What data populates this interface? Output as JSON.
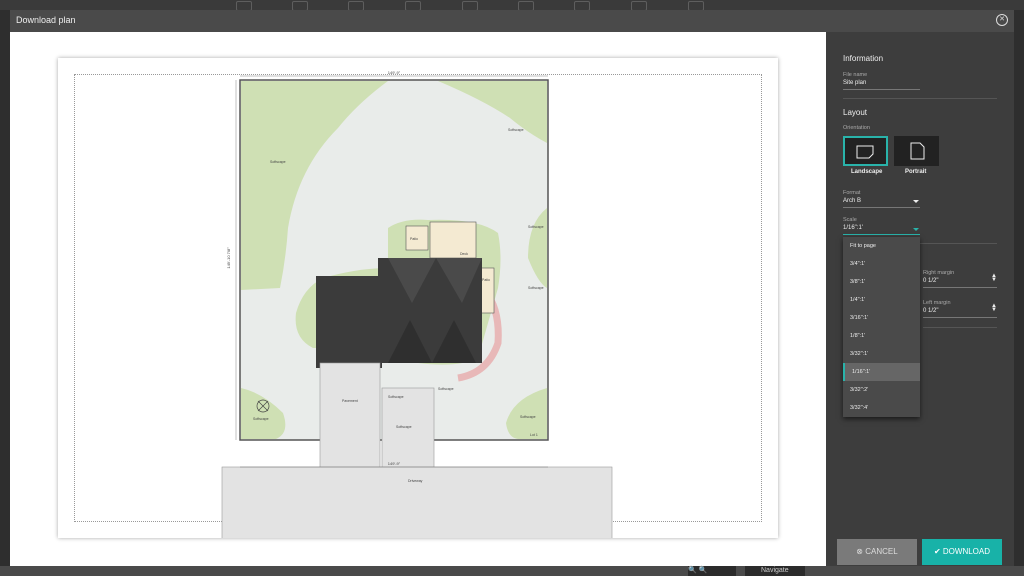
{
  "modal": {
    "title": "Download plan",
    "close_icon": "close-circle-icon"
  },
  "panel": {
    "information": {
      "title": "Information",
      "file_name_label": "File name",
      "file_name_value": "Site plan"
    },
    "layout": {
      "title": "Layout",
      "orientation_label": "Orientation",
      "orientations": [
        {
          "label": "Landscape",
          "selected": true
        },
        {
          "label": "Portrait",
          "selected": false
        }
      ],
      "format_label": "Format",
      "format_value": "Arch B",
      "scale_label": "Scale",
      "scale_value": "1/16\":1'",
      "scale_options": [
        "Fit to page",
        "3/4\":1'",
        "3/8\":1'",
        "1/4\":1'",
        "3/16\":1'",
        "1/8\":1'",
        "3/32\":1'",
        "1/16\":1'",
        "3/32\":2'",
        "3/32\":4'"
      ],
      "scale_selected": "1/16\":1'",
      "right_margin_label": "Right margin",
      "right_margin_value": "0 1/2\"",
      "left_margin_label": "Left margin",
      "left_margin_value": "0 1/2\""
    },
    "buttons": {
      "cancel": "CANCEL",
      "download": "DOWNLOAD"
    }
  },
  "plan": {
    "dim_top": "149'-9\"",
    "dim_mid": "149'-9\"",
    "dim_left": "149'-10 7/8\"",
    "labels": {
      "softscape": "Softscape",
      "patio": "Patio",
      "deck": "Deck",
      "pavement": "Pavement",
      "driveway": "Driveway",
      "lot": "Lot 1",
      "gazebo": "Softscape"
    }
  },
  "statusbar": {
    "navigate": "Navigate"
  },
  "colors": {
    "accent": "#18b2a8",
    "lawn": "#cfe0b4",
    "yard": "#e9ecea",
    "roof": "#3b3b3b",
    "paving": "#e3e3e3"
  }
}
